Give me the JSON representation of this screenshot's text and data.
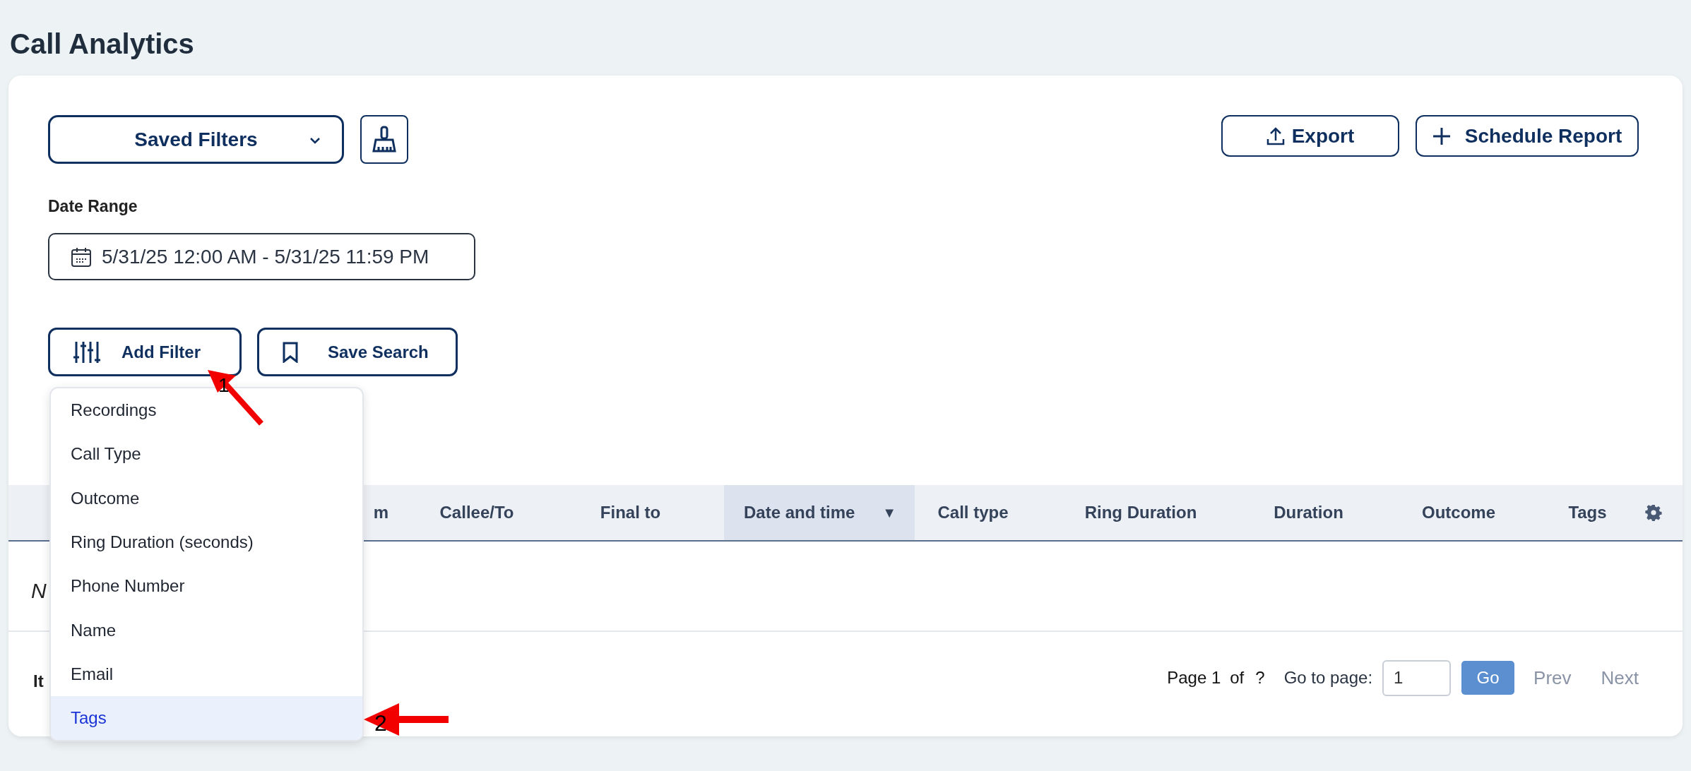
{
  "page": {
    "title": "Call Analytics"
  },
  "toolbar": {
    "saved_filters": "Saved Filters",
    "export": "Export",
    "schedule_report": "Schedule Report"
  },
  "date_range": {
    "label": "Date Range",
    "value": "5/31/25 12:00 AM - 5/31/25 11:59 PM"
  },
  "filter_buttons": [
    {
      "kind": "filter",
      "label": "Add Filter"
    },
    {
      "kind": "bookmark",
      "label": "Save Search"
    }
  ],
  "filter_menu": [
    {
      "label": "Recordings",
      "selected": false
    },
    {
      "label": "Call Type",
      "selected": false
    },
    {
      "label": "Outcome",
      "selected": false
    },
    {
      "label": "Ring Duration (seconds)",
      "selected": false
    },
    {
      "label": "Phone Number",
      "selected": false
    },
    {
      "label": "Name",
      "selected": false
    },
    {
      "label": "Email",
      "selected": false
    },
    {
      "label": "Tags",
      "selected": true
    }
  ],
  "table": {
    "columns": [
      {
        "label": "m",
        "sorted": false
      },
      {
        "label": "Callee/To",
        "sorted": false
      },
      {
        "label": "Final to",
        "sorted": false
      },
      {
        "label": "Date and time",
        "sorted": true,
        "sort_indicator": "▼"
      },
      {
        "label": "Call type",
        "sorted": false
      },
      {
        "label": "Ring Duration",
        "sorted": false
      },
      {
        "label": "Duration",
        "sorted": false
      },
      {
        "label": "Outcome",
        "sorted": false
      },
      {
        "label": "Tags",
        "sorted": false
      }
    ],
    "empty_message": "N"
  },
  "footer": {
    "items_label": "It",
    "page_label": "Page 1",
    "of_label": "of",
    "total_pages": "?",
    "go_to_label": "Go to page:",
    "page_input": "1",
    "go": "Go",
    "prev": "Prev",
    "next": "Next"
  },
  "annotations": [
    {
      "number": "1"
    },
    {
      "number": "2"
    }
  ]
}
